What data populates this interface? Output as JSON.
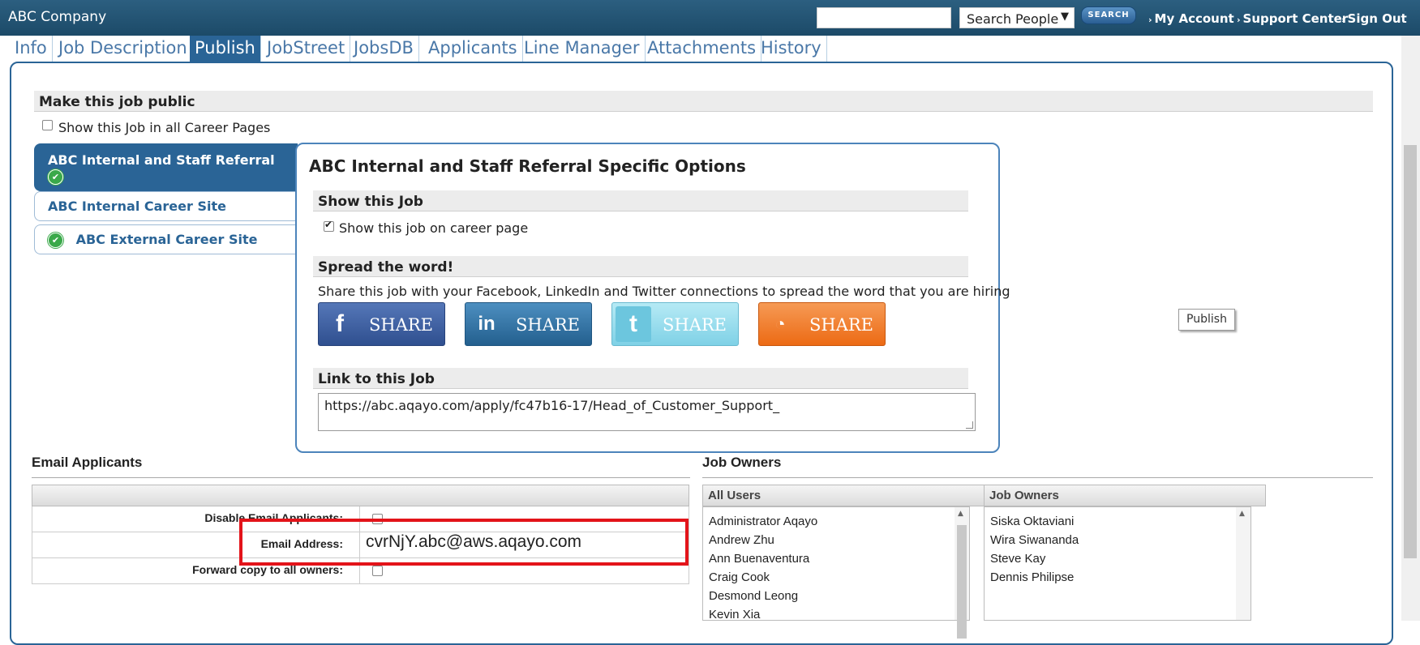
{
  "header": {
    "brand": "ABC Company",
    "search_input_value": "",
    "search_select": "Search People",
    "search_button": "SEARCH",
    "links": [
      "My Account",
      "Support Center",
      "Sign Out"
    ]
  },
  "tabs": [
    "Info",
    "Job Description",
    "Publish",
    "JobStreet",
    "JobsDB",
    "Applicants",
    "Line Manager",
    "Attachments",
    "History"
  ],
  "active_tab": "Publish",
  "publish": {
    "section_title": "Make this job public",
    "show_all_label": "Show this Job in all Career Pages",
    "sites": [
      {
        "label": "ABC Internal and Staff Referral",
        "status": "check-icon"
      },
      {
        "label": "ABC Internal Career Site"
      },
      {
        "label": "ABC External Career Site",
        "status": "check-icon"
      }
    ],
    "options": {
      "title": "ABC Internal and Staff Referral Specific Options",
      "show_job_heading": "Show this Job",
      "show_on_career_label": "Show this job on career page",
      "spread_heading": "Spread the word!",
      "spread_text": "Share this job with your Facebook, LinkedIn and Twitter connections to spread the word that you are hiring",
      "share_buttons": [
        {
          "name": "facebook",
          "label": "SHARE",
          "color": "#3b5998"
        },
        {
          "name": "linkedin",
          "label": "SHARE",
          "color": "#2d6f9f"
        },
        {
          "name": "twitter",
          "label": "SHARE",
          "color": "#7fd1e6"
        },
        {
          "name": "rss",
          "label": "SHARE",
          "color": "#f27a22"
        }
      ],
      "link_heading": "Link to this Job",
      "link_value": "https://abc.aqayo.com/apply/fc47b16-17/Head_of_Customer_Support_"
    },
    "publish_button": "Publish"
  },
  "email_applicants": {
    "title": "Email Applicants",
    "disable_label": "Disable Email Applicants:",
    "email_label": "Email Address:",
    "email_value": "cvrNjY.abc@aws.aqayo.com",
    "forward_label": "Forward copy to all owners:"
  },
  "job_owners": {
    "title": "Job Owners",
    "all_users_header": "All Users",
    "owners_header": "Job Owners",
    "all_users": [
      "Administrator Aqayo",
      "Andrew Zhu",
      "Ann Buenaventura",
      "Craig Cook",
      "Desmond Leong",
      "Kevin Xia"
    ],
    "owners": [
      "Siska Oktaviani",
      "Wira Siwananda",
      "Steve Kay",
      "Dennis Philipse"
    ]
  },
  "colors": {
    "header_bg": "#1c4a68",
    "accent": "#2a6496",
    "highlight": "#e3141a"
  }
}
